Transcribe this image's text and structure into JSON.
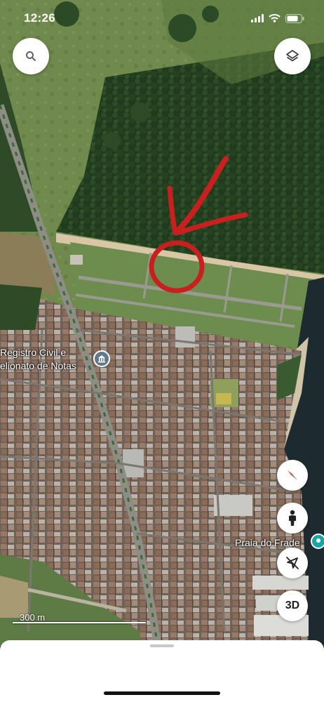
{
  "status_bar": {
    "time": "12:26"
  },
  "map": {
    "type": "satellite",
    "place_labels": [
      {
        "text": "Registro Civil e"
      },
      {
        "text": "elionato de Notas"
      },
      {
        "text": "Praia do Frade"
      }
    ],
    "scale_label": "300 m"
  },
  "controls": {
    "search_icon": "search-icon",
    "layers_icon": "layers-icon",
    "compass_icon": "compass-icon",
    "street_view_icon": "pegman-icon",
    "location_icon": "location-off-icon",
    "three_d_label": "3D"
  },
  "colors": {
    "annotation_red": "#c8201e",
    "pin_gray": "#5f7a8c",
    "pin_teal": "#1aa5a5"
  }
}
